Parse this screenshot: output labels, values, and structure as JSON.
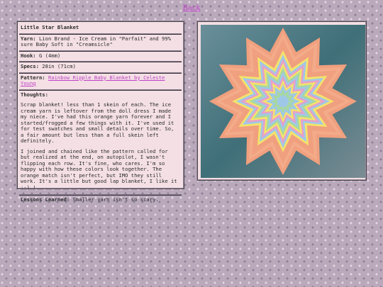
{
  "nav": {
    "back_label": "Back"
  },
  "project": {
    "title": "Little Star Blanket",
    "yarn_label": "Yarn:",
    "yarn_value": "Lion Brand - Ice Cream in \"Parfait\" and 99% sure Baby Soft in \"Creamsicle\"",
    "hook_label": "Hook:",
    "hook_value": "G (4mm)",
    "specs_label": "Specs:",
    "specs_value": "28in (71cm)",
    "pattern_label": "Pattern:",
    "pattern_link": "Rainbow Ripple Baby Blanket by Celeste Young",
    "thoughts_label": "Thoughts:",
    "thoughts_p1": "Scrap blanket! less than 1 skein of each. The ice cream yarn is leftover from the doll dress I made my niece. I've had this orange yarn forever and I started/frogged a few things with it. I've used it for test swatches and small details over time. So, a fair amount but less than a full skein left definitely.",
    "thoughts_p2": "I joined and chained like the pattern called for but realized at the end, on autopilot, I wasn't flipping each row. It's fine, who cares. I'm so happy with how these colors look together. The orange match isn't perfect, but IMO they still work. It's a little but good lap blanket, I like it :-) !",
    "lessons_label": "Lessons Learned:",
    "lessons_value": "Smaller yarn isn't so scary."
  },
  "colors": {
    "link": "#c040c8",
    "card_bg": "#f3dfe4",
    "blanket_orange": "#f0a07e",
    "photo_bg": "#4f7f86"
  }
}
